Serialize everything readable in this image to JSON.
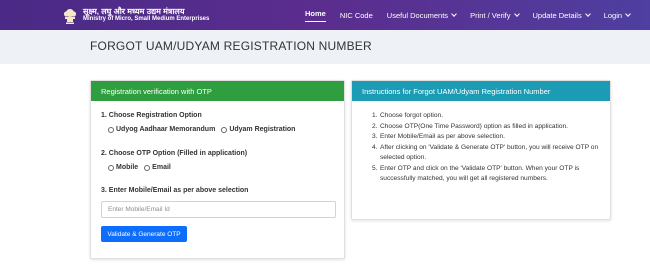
{
  "header": {
    "brand_hindi": "सूक्ष्म, लघु और मध्यम उद्यम मंत्रालय",
    "brand_english": "Ministry of Micro, Small Medium Enterprises",
    "nav": [
      {
        "label": "Home"
      },
      {
        "label": "NIC Code"
      },
      {
        "label": "Useful Documents"
      },
      {
        "label": "Print / Verify"
      },
      {
        "label": "Update Details"
      },
      {
        "label": "Login"
      }
    ]
  },
  "page_title": "FORGOT UAM/UDYAM REGISTRATION NUMBER",
  "form": {
    "heading": "Registration verification with OTP",
    "step1": "1. Choose Registration Option",
    "step1_options": [
      "Udyog Aadhaar Memorandum",
      "Udyam Registration"
    ],
    "step2": "2. Choose OTP Option (Filled in application)",
    "step2_options": [
      "Mobile",
      "Email"
    ],
    "step3": "3. Enter Mobile/Email as per above selection",
    "input_placeholder": "Enter Mobile/Email Id",
    "submit_label": "Validate & Generate OTP"
  },
  "instructions": {
    "heading": "Instructions for Forgot UAM/Udyam Registration Number",
    "items": [
      {
        "num": "1.",
        "text": "Choose forgot option."
      },
      {
        "num": "2.",
        "text": "Choose OTP(One Time Password) option as filled in application."
      },
      {
        "num": "3.",
        "text": "Enter Mobile/Email as per above selection."
      },
      {
        "num": "4.",
        "text": "After clicking on 'Validate & Generate OTP' button, you will receive OTP on selected option."
      },
      {
        "num": "5.",
        "text": "Enter OTP and click on the 'Validate OTP' button. When your OTP is successfully matched, you will get all registered numbers."
      }
    ]
  },
  "colors": {
    "navbar": "#5b2d8e",
    "form_header": "#2e9e3f",
    "instructions_header": "#1c9cb4",
    "button": "#0d6efd"
  }
}
